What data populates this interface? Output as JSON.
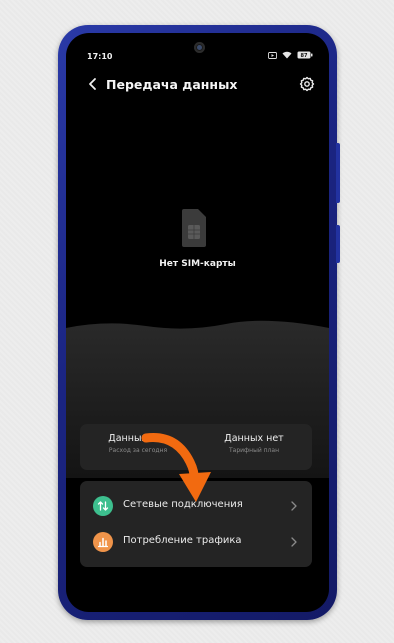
{
  "status_bar": {
    "time": "17:10",
    "battery": "87"
  },
  "header": {
    "title": "Передача данных"
  },
  "sim": {
    "message": "Нет SIM-карты"
  },
  "data_card": {
    "left_value": "Данных нет",
    "left_caption": "Расход за сегодня",
    "right_value": "Данных нет",
    "right_caption": "Тарифный план"
  },
  "menu": {
    "items": [
      {
        "label": "Сетевые подключения",
        "icon": "arrows-updown-icon",
        "color": "#3dbf8e"
      },
      {
        "label": "Потребление трафика",
        "icon": "chart-icon",
        "color": "#f0944a"
      }
    ]
  },
  "colors": {
    "arrow": "#f26a10",
    "phone_frame": "#1b2583"
  }
}
